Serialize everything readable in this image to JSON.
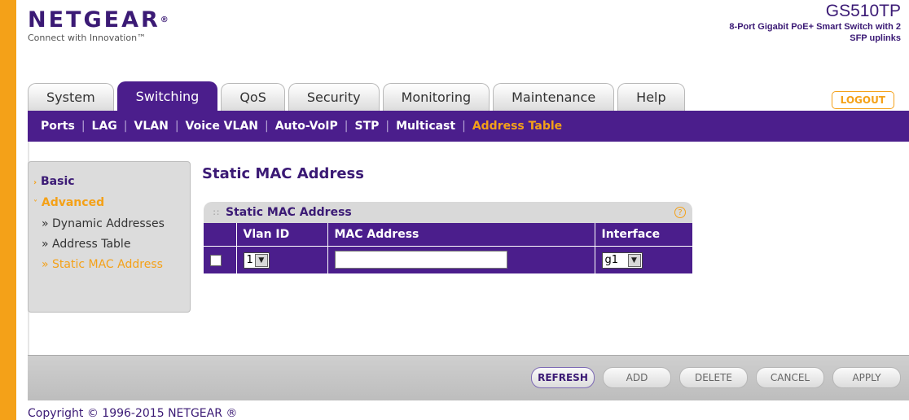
{
  "header": {
    "logo_text": "NETGEAR",
    "logo_mark": "®",
    "tagline": "Connect with Innovation™",
    "model": "GS510TP",
    "description": "8-Port Gigabit PoE+ Smart Switch with 2 SFP uplinks"
  },
  "tabs": [
    {
      "label": "System"
    },
    {
      "label": "Switching"
    },
    {
      "label": "QoS"
    },
    {
      "label": "Security"
    },
    {
      "label": "Monitoring"
    },
    {
      "label": "Maintenance"
    },
    {
      "label": "Help"
    }
  ],
  "active_tab": "Switching",
  "logout_label": "LOGOUT",
  "subnav": [
    {
      "label": "Ports"
    },
    {
      "label": "LAG"
    },
    {
      "label": "VLAN"
    },
    {
      "label": "Voice VLAN"
    },
    {
      "label": "Auto-VoIP"
    },
    {
      "label": "STP"
    },
    {
      "label": "Multicast"
    },
    {
      "label": "Address Table"
    }
  ],
  "subnav_separator": "|",
  "sidebar": {
    "basic": "Basic",
    "advanced": "Advanced",
    "items": [
      {
        "label": "Dynamic Addresses"
      },
      {
        "label": "Address Table"
      },
      {
        "label": "Static MAC Address"
      }
    ]
  },
  "page_title": "Static MAC Address",
  "panel": {
    "title": "Static MAC Address",
    "help_icon": "?",
    "columns": [
      "Vlan ID",
      "MAC Address",
      "Interface"
    ],
    "row": {
      "vlan_id": "1",
      "mac_address": "",
      "interface": "g1"
    }
  },
  "buttons": {
    "refresh": "REFRESH",
    "add": "ADD",
    "delete": "DELETE",
    "cancel": "CANCEL",
    "apply": "APPLY"
  },
  "copyright": "Copyright © 1996-2015 NETGEAR ®",
  "colors": {
    "brand_purple": "#4b1e8c",
    "accent_orange": "#f4a118"
  }
}
